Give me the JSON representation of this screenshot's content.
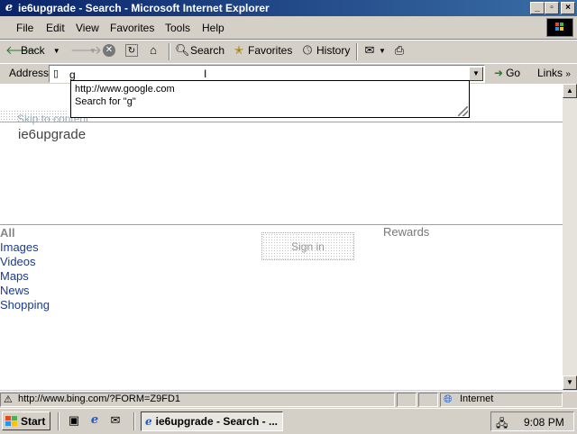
{
  "window": {
    "title": "ie6upgrade - Search - Microsoft Internet Explorer",
    "app_icon": "ie-icon",
    "controls": [
      "minimize",
      "maximize",
      "close"
    ]
  },
  "menu": {
    "items": [
      {
        "label": "File",
        "accel": "F"
      },
      {
        "label": "Edit",
        "accel": "E"
      },
      {
        "label": "View",
        "accel": "V"
      },
      {
        "label": "Favorites",
        "accel": "a"
      },
      {
        "label": "Tools",
        "accel": "T"
      },
      {
        "label": "Help",
        "accel": "H"
      }
    ]
  },
  "toolbar": {
    "back_label": "Back",
    "search_label": "Search",
    "favorites_label": "Favorites",
    "history_label": "History"
  },
  "address": {
    "label": "Address",
    "value": "g",
    "go_label": "Go",
    "links_label": "Links"
  },
  "autocomplete": {
    "items": [
      "http://www.google.com",
      "Search for \"g\""
    ]
  },
  "page": {
    "skip_link": "Skip to content",
    "logo_text": "ie6upgrade",
    "nav": [
      "All",
      "Images",
      "Videos",
      "Maps",
      "News",
      "Shopping"
    ],
    "rewards_label": "Rewards",
    "signin_label": "Sign in"
  },
  "status": {
    "url": "http://www.bing.com/?FORM=Z9FD1",
    "zone": "Internet"
  },
  "taskbar": {
    "start_label": "Start",
    "task_label": "ie6upgrade - Search - ...",
    "clock": "9:08 PM"
  },
  "colors": {
    "titlebar_start": "#0a246a",
    "titlebar_end": "#3a6ea5",
    "chrome": "#d4d0c8",
    "link": "#1a3a8c"
  }
}
